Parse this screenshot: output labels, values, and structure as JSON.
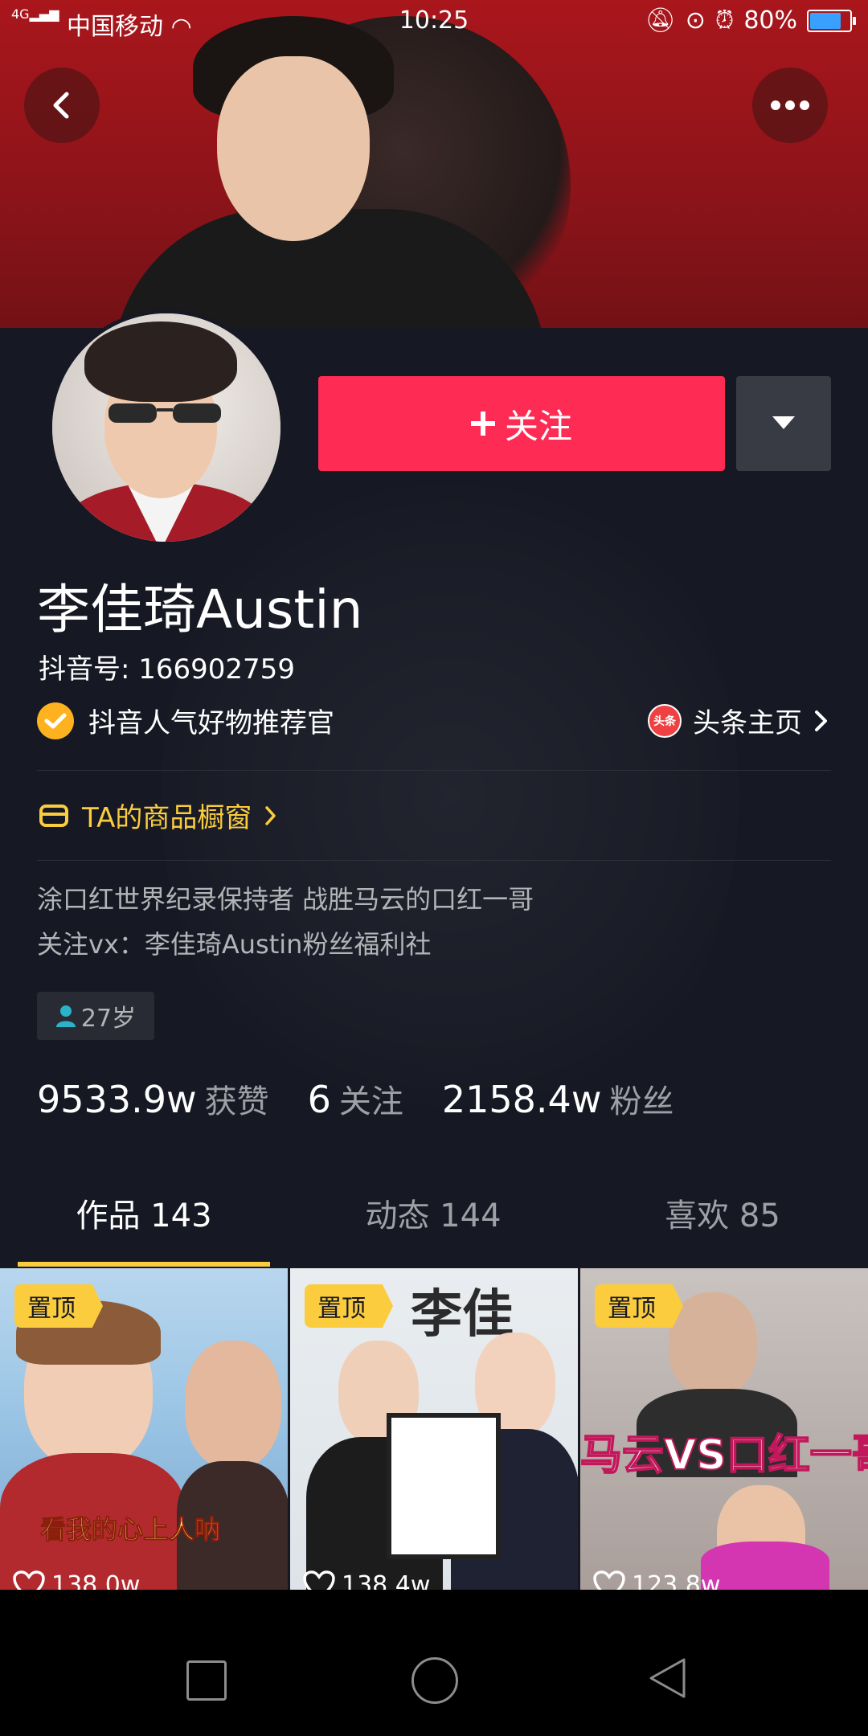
{
  "status_bar": {
    "carrier": "中国移动",
    "time": "10:25",
    "battery": "80%",
    "battery_level": 0.8
  },
  "profile": {
    "follow_label": "关注",
    "name": "李佳琦Austin",
    "douyin_id": "抖音号: 166902759",
    "verification": "抖音人气好物推荐官",
    "toutiao_label": "头条主页",
    "toutiao_icon_text": "头条",
    "shop_label": "TA的商品橱窗",
    "bio_line1": "涂口红世界纪录保持者 战胜马云的口红一哥",
    "bio_line2": "关注vx：李佳琦Austin粉丝福利社",
    "age": "27岁"
  },
  "stats": {
    "likes_value": "9533.9w",
    "likes_label": "获赞",
    "following_value": "6",
    "following_label": "关注",
    "followers_value": "2158.4w",
    "followers_label": "粉丝"
  },
  "tabs": [
    {
      "label": "作品",
      "count": "143"
    },
    {
      "label": "动态",
      "count": "144"
    },
    {
      "label": "喜欢",
      "count": "85"
    }
  ],
  "videos": [
    {
      "pin": "置顶",
      "likes": "138.0w",
      "caption": "看我的心上人呐"
    },
    {
      "pin": "置顶",
      "likes": "138.4w",
      "caption": "李佳"
    },
    {
      "pin": "置顶",
      "likes": "123.8w",
      "caption": "马云VS口红一哥"
    }
  ],
  "colors": {
    "accent": "#fe2c55",
    "gold": "#facc3e",
    "background": "#161823"
  }
}
